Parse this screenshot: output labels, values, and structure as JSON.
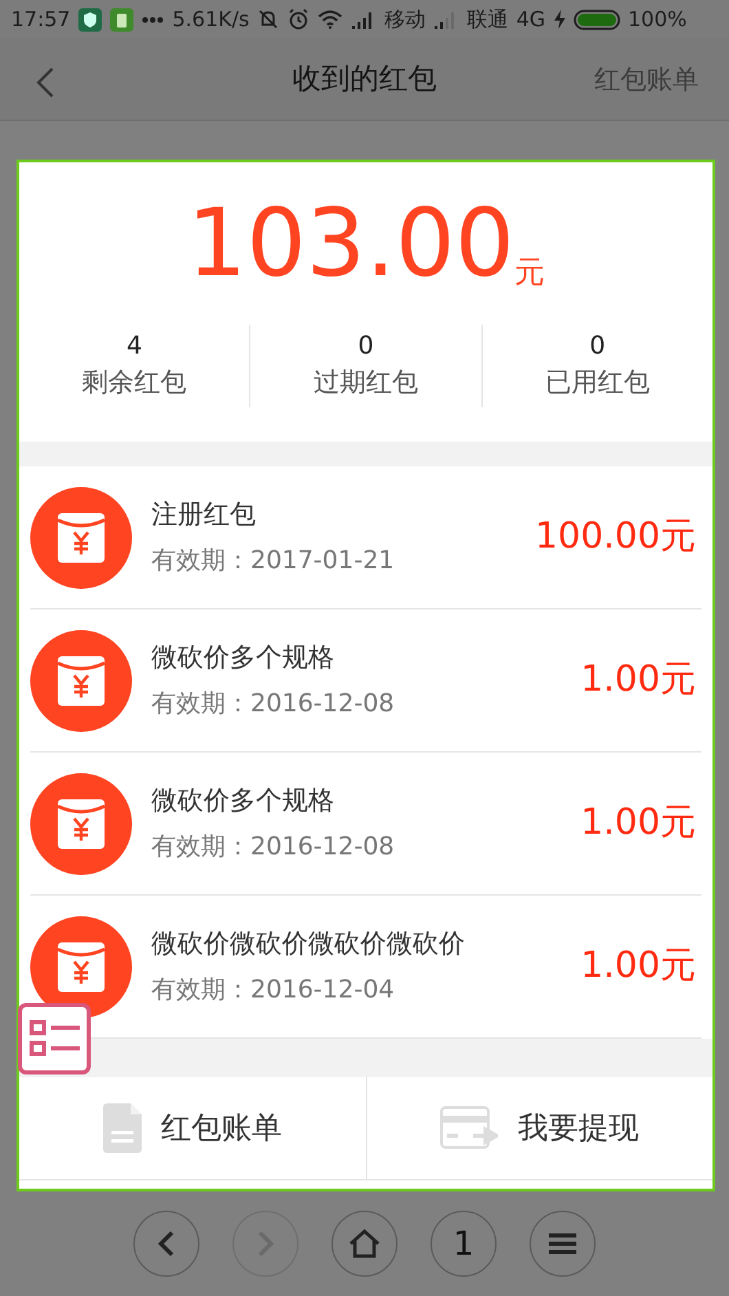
{
  "status_bar": {
    "time": "17:57",
    "speed": "5.61K/s",
    "carrier_1": "移动",
    "carrier_2": "联通",
    "network": "4G",
    "battery": "100%"
  },
  "header": {
    "title": "收到的红包",
    "action": "红包账单"
  },
  "summary": {
    "amount": "103.00",
    "unit": "元",
    "stats": [
      {
        "value": "4",
        "label": "剩余红包"
      },
      {
        "value": "0",
        "label": "过期红包"
      },
      {
        "value": "0",
        "label": "已用红包"
      }
    ]
  },
  "packets": [
    {
      "title": "注册红包",
      "validity": "有效期：2017-01-21",
      "amount": "100.00元"
    },
    {
      "title": "微砍价多个规格",
      "validity": "有效期：2016-12-08",
      "amount": "1.00元"
    },
    {
      "title": "微砍价多个规格",
      "validity": "有效期：2016-12-08",
      "amount": "1.00元"
    },
    {
      "title": "微砍价微砍价微砍价微砍价",
      "validity": "有效期：2016-12-04",
      "amount": "1.00元"
    }
  ],
  "actions": [
    {
      "kind": "bill",
      "label": "红包账单"
    },
    {
      "kind": "withdraw",
      "label": "我要提现"
    }
  ],
  "browser_nav": [
    {
      "kind": "back",
      "disabled": false
    },
    {
      "kind": "forward",
      "disabled": true
    },
    {
      "kind": "home",
      "disabled": false
    },
    {
      "kind": "tabs",
      "label": "1",
      "disabled": false
    },
    {
      "kind": "menu",
      "disabled": false
    }
  ]
}
